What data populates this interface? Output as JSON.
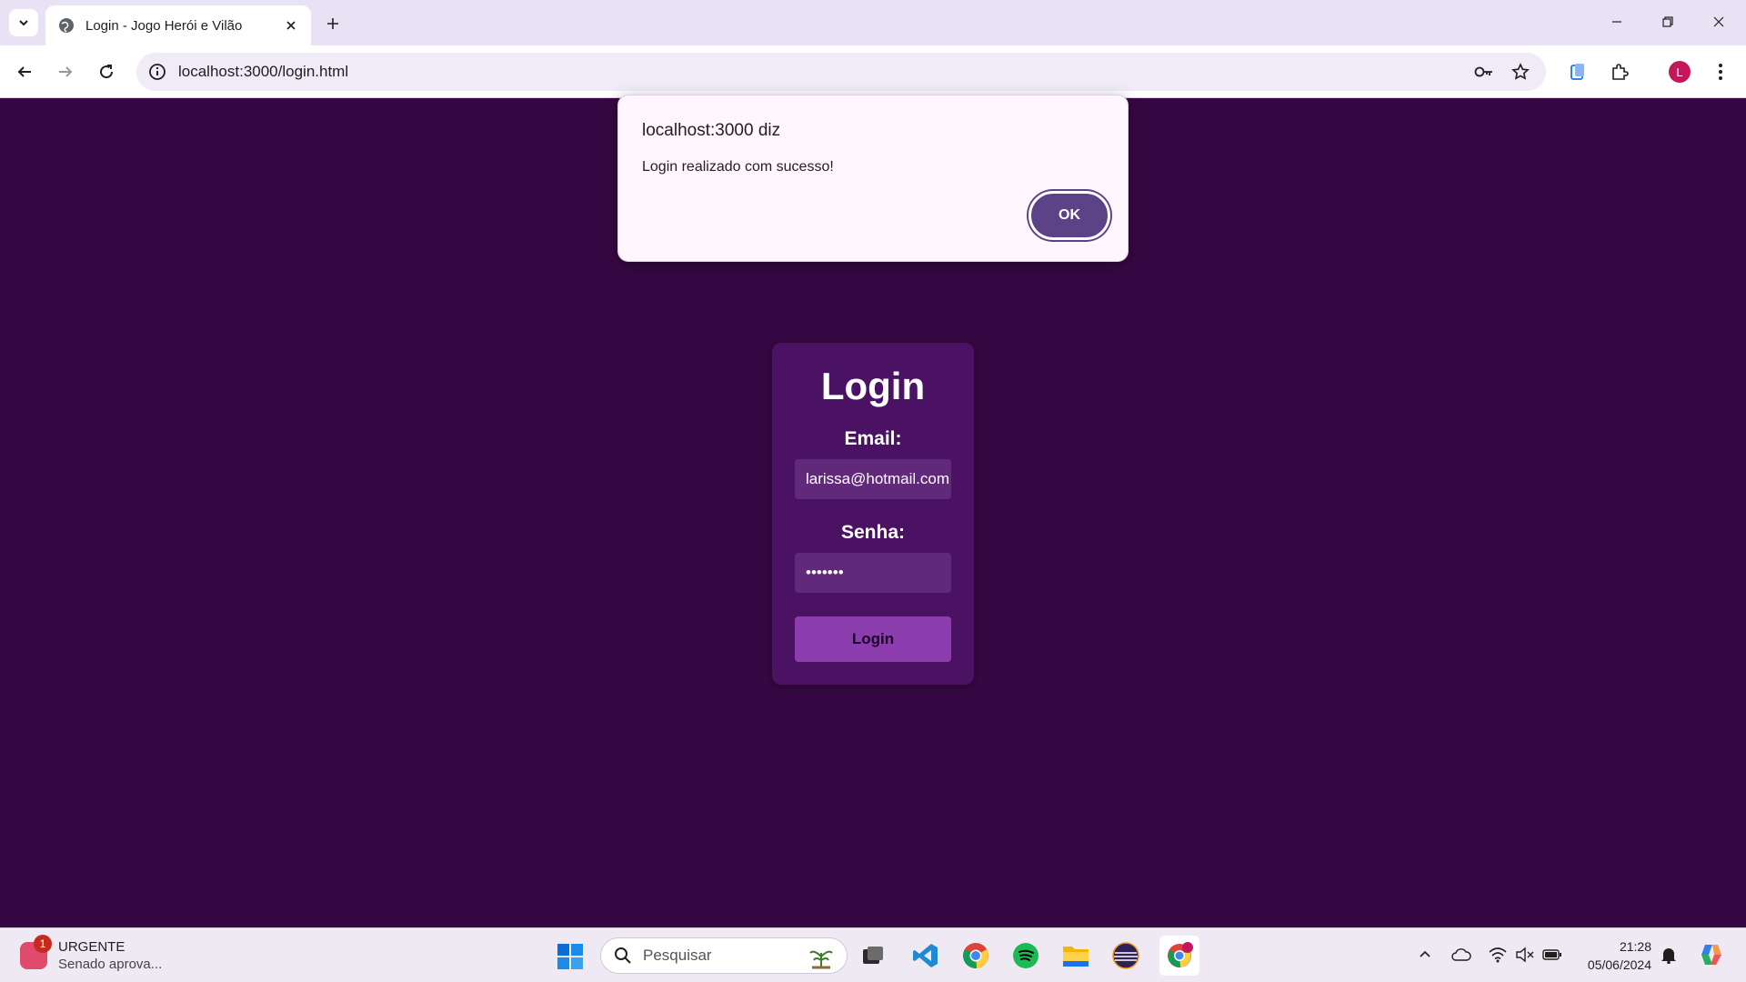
{
  "browser": {
    "tab_title": "Login - Jogo Herói e Vilão",
    "url": "localhost:3000/login.html"
  },
  "profile": {
    "initial": "L"
  },
  "alert": {
    "title": "localhost:3000 diz",
    "message": "Login realizado com sucesso!",
    "ok_label": "OK"
  },
  "login": {
    "title": "Login",
    "email_label": "Email:",
    "email_value": "larissa@hotmail.com",
    "password_label": "Senha:",
    "password_value": "•••••••",
    "button_label": "Login"
  },
  "taskbar": {
    "news_badge": "1",
    "news_title": "URGENTE",
    "news_subtitle": "Senado aprova...",
    "search_placeholder": "Pesquisar",
    "time": "21:28",
    "date": "05/06/2024"
  },
  "colors": {
    "page_background": "#360843",
    "card_background": "#4b1264",
    "input_background": "#61297a",
    "button_background": "#8b3dae",
    "alert_ok_background": "#5c4387"
  }
}
